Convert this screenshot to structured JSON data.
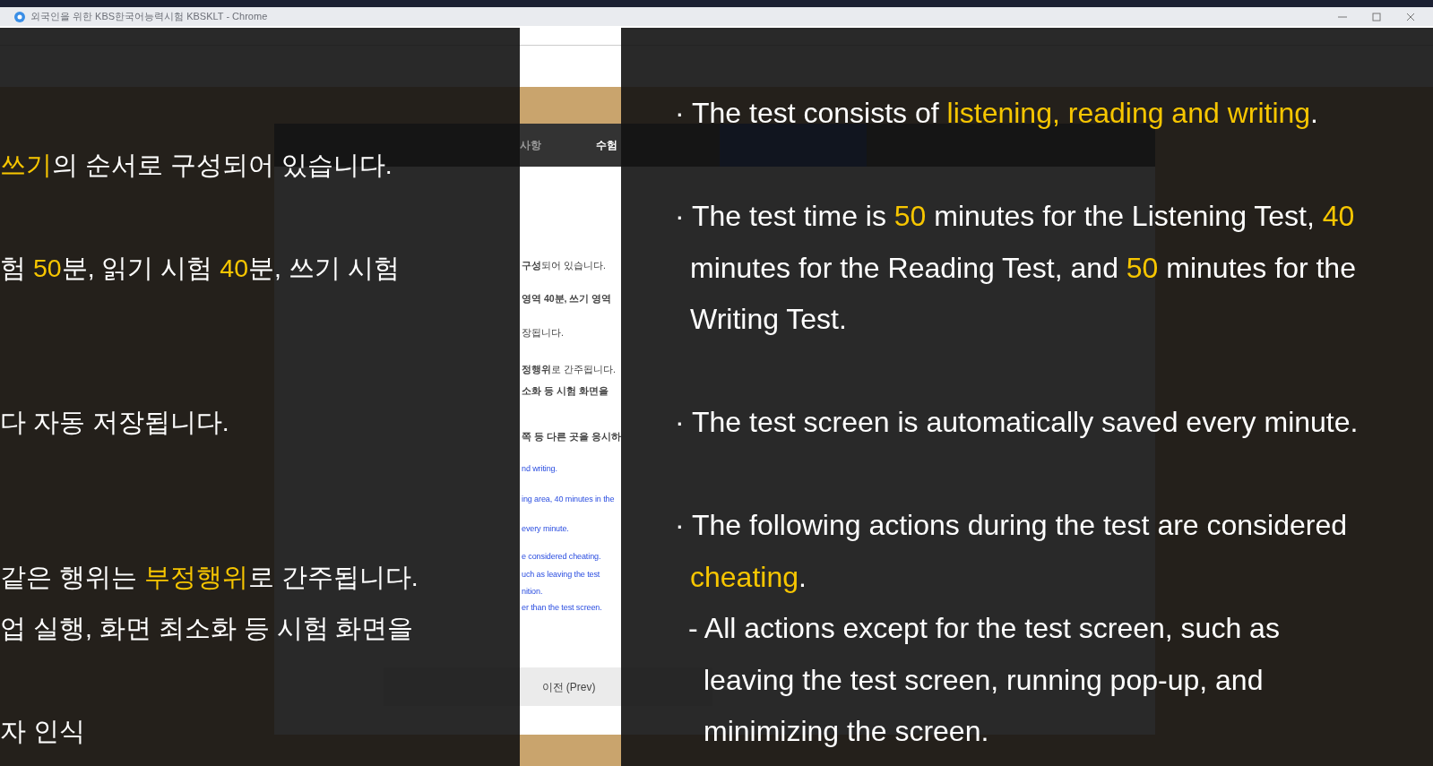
{
  "browser": {
    "title": "외국인을 위한 KBS한국어능력시험 KBSKLT - Chrome"
  },
  "dialog": {
    "tab_fragments": [
      "사항",
      "수험"
    ],
    "fragments": [
      {
        "kind": "ko",
        "text": "**구성**되어 있습니다."
      },
      {
        "kind": "ko",
        "text": "**영역 40분, 쓰기 영역**"
      },
      {
        "kind": "ko",
        "text": "장됩니다."
      },
      {
        "kind": "ko",
        "text": "**정행위**로 간주됩니다."
      },
      {
        "kind": "ko_sub",
        "text": "소화 등 시험 화면을"
      },
      {
        "kind": "ko_sub",
        "text": "쪽 등 다른 곳을 응시하"
      },
      {
        "kind": "en",
        "text": "nd writing."
      },
      {
        "kind": "en",
        "text": "ing area, 40 minutes in the"
      },
      {
        "kind": "en",
        "text": "every minute."
      },
      {
        "kind": "en",
        "text": "e considered cheating."
      },
      {
        "kind": "en",
        "text": "uch as leaving the test"
      },
      {
        "kind": "en",
        "text": "nition."
      },
      {
        "kind": "en",
        "text": "er than the test screen."
      }
    ],
    "prev_button": "이전 (Prev)"
  },
  "subtitles": {
    "left": [
      {
        "parts": [
          {
            "text": "쓰기",
            "highlight": true
          },
          {
            "text": "의 순서로 구성되어 있습니다.",
            "highlight": false
          }
        ]
      },
      {
        "parts": [
          {
            "text": "험 ",
            "highlight": false
          },
          {
            "text": "50",
            "highlight": true
          },
          {
            "text": "분, 읽기 시험 ",
            "highlight": false
          },
          {
            "text": "40",
            "highlight": true
          },
          {
            "text": "분, 쓰기 시험",
            "highlight": false
          }
        ]
      },
      {
        "parts": [
          {
            "text": "다 자동 저장됩니다.",
            "highlight": false
          }
        ]
      },
      {
        "parts": [
          {
            "text": "같은 행위는 ",
            "highlight": false
          },
          {
            "text": "부정행위",
            "highlight": true
          },
          {
            "text": "로 간주됩니다.",
            "highlight": false
          }
        ]
      },
      {
        "parts": [
          {
            "text": "업 실행, 화면 최소화 등 시험 화면을",
            "highlight": false
          }
        ]
      },
      {
        "parts": [
          {
            "text": "자 인식",
            "highlight": false
          }
        ]
      }
    ],
    "right": [
      {
        "kind": "bullet",
        "parts": [
          {
            "text": "· The test consists of ",
            "highlight": false
          },
          {
            "text": "listening, reading and writing",
            "highlight": true
          },
          {
            "text": ".",
            "highlight": false
          }
        ]
      },
      {
        "kind": "bullet",
        "parts": [
          {
            "text": "· The test time is ",
            "highlight": false
          },
          {
            "text": "50",
            "highlight": true
          },
          {
            "text": " minutes for the Listening Test, ",
            "highlight": false
          },
          {
            "text": "40",
            "highlight": true
          },
          {
            "text": " minutes for the Reading Test, and ",
            "highlight": false
          },
          {
            "text": "50",
            "highlight": true
          },
          {
            "text": " minutes for the Writing Test.",
            "highlight": false
          }
        ]
      },
      {
        "kind": "bullet",
        "parts": [
          {
            "text": "· The test screen is automatically saved every minute.",
            "highlight": false
          }
        ]
      },
      {
        "kind": "bullet",
        "parts": [
          {
            "text": "· The following actions during the test are considered ",
            "highlight": false
          },
          {
            "text": "cheating",
            "highlight": true
          },
          {
            "text": ".",
            "highlight": false
          }
        ]
      },
      {
        "kind": "sub",
        "parts": [
          {
            "text": "- All actions except for the test screen, such as leaving the test screen, running pop-up, and minimizing the screen.",
            "highlight": false
          }
        ]
      }
    ]
  }
}
